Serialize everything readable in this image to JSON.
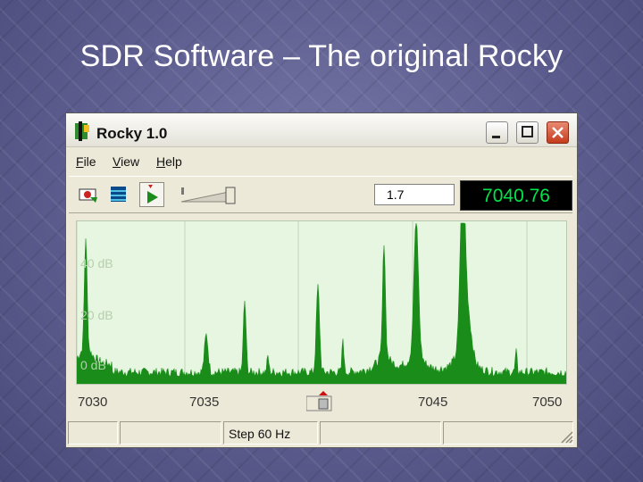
{
  "slide": {
    "title": "SDR Software – The original Rocky"
  },
  "window": {
    "title": "Rocky 1.0"
  },
  "menu": {
    "items": [
      "File",
      "View",
      "Help"
    ]
  },
  "toolbar": {
    "buttons": [
      "settings-icon",
      "waterfall-icon",
      "play-icon"
    ],
    "gain_value": "1.7",
    "frequency_display": "7040.76"
  },
  "spectrum": {
    "db_labels": [
      "40 dB",
      "20 dB",
      "0 dB"
    ],
    "freq_ticks": [
      "7030",
      "7035",
      "7045",
      "7050"
    ],
    "trace_color": "#1a8c1a",
    "background_color": "#e6f6e0"
  },
  "status": {
    "step": "Step 60 Hz"
  },
  "colors": {
    "display_bg": "#000000",
    "display_fg": "#00e44a",
    "close_button": "#c53b1c"
  }
}
